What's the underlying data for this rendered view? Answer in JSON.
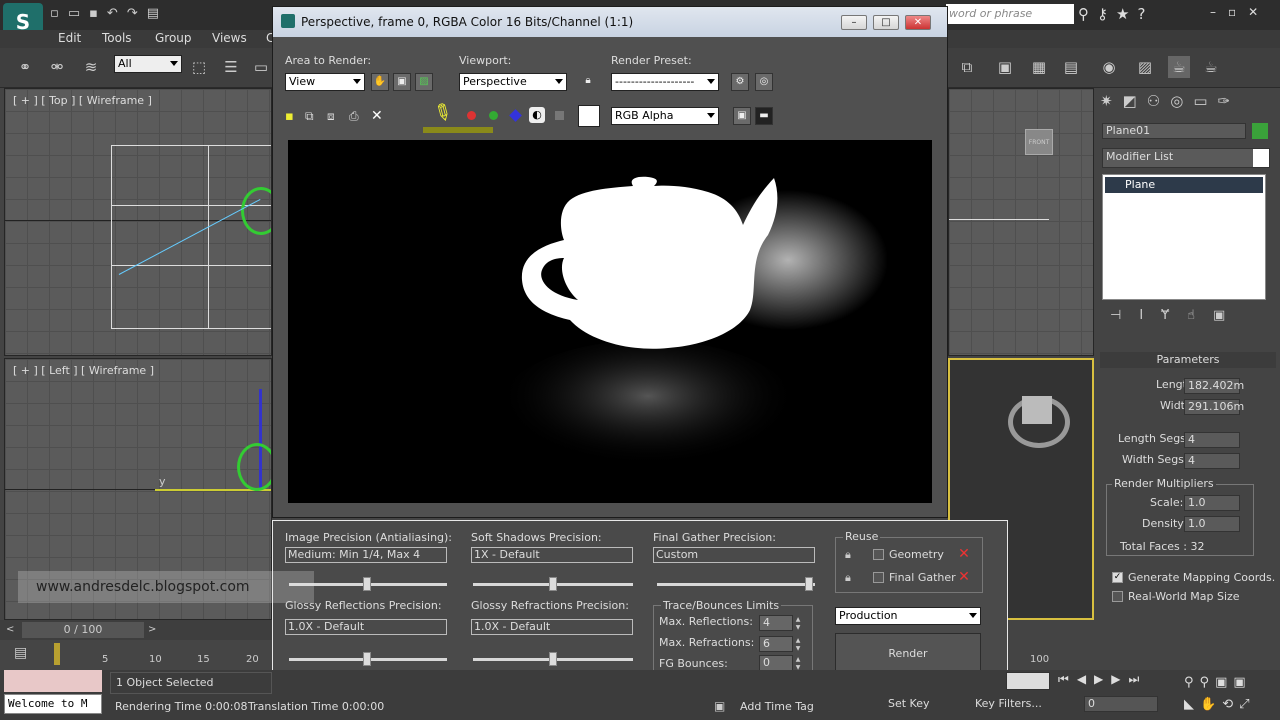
{
  "app": {
    "search_placeholder": "word or phrase"
  },
  "menu": {
    "items": [
      "Edit",
      "Tools",
      "Group",
      "Views",
      "C"
    ]
  },
  "toolbar": {
    "selection_filter": "All"
  },
  "viewports": {
    "top_label": "[ + ] [ Top ] [ Wireframe ]",
    "left_label": "[ + ] [ Left ] [ Wireframe ]",
    "axis_y": "y"
  },
  "render_window": {
    "title": "Perspective, frame 0, RGBA Color 16 Bits/Channel (1:1)",
    "area_label": "Area to Render:",
    "area_value": "View",
    "viewport_label": "Viewport:",
    "viewport_value": "Perspective",
    "preset_label": "Render Preset:",
    "preset_value": "--------------------",
    "channel_value": "RGB Alpha",
    "minimize": "–",
    "maximize": "□",
    "close": "✕"
  },
  "precision_panel": {
    "image_precision_label": "Image Precision (Antialiasing):",
    "image_precision_value": "Medium: Min 1/4, Max 4",
    "soft_shadows_label": "Soft Shadows Precision:",
    "soft_shadows_value": "1X - Default",
    "final_gather_label": "Final Gather Precision:",
    "final_gather_value": "Custom",
    "glossy_refl_label": "Glossy Reflections Precision:",
    "glossy_refl_value": "1.0X - Default",
    "glossy_refr_label": "Glossy Refractions Precision:",
    "glossy_refr_value": "1.0X - Default",
    "reuse_label": "Reuse",
    "geometry_label": "Geometry",
    "final_gather_chk_label": "Final Gather",
    "trace_label": "Trace/Bounces Limits",
    "max_refl_label": "Max. Reflections:",
    "max_refl_value": "4",
    "max_refr_label": "Max. Refractions:",
    "max_refr_value": "6",
    "fg_bounces_label": "FG Bounces:",
    "fg_bounces_value": "0",
    "production_value": "Production",
    "render_button": "Render",
    "watermark": "www.andresdelc.blogspot.com"
  },
  "command_panel": {
    "object_name": "Plane01",
    "modifier_list": "Modifier List",
    "stack_item": "Plane",
    "parameters_title": "Parameters",
    "length_label": "Length:",
    "length_value": "182.402m",
    "width_label": "Width:",
    "width_value": "291.106m",
    "length_segs_label": "Length Segs:",
    "length_segs_value": "4",
    "width_segs_label": "Width Segs:",
    "width_segs_value": "4",
    "render_mult_label": "Render Multipliers",
    "scale_label": "Scale:",
    "scale_value": "1.0",
    "density_label": "Density:",
    "density_value": "1.0",
    "total_faces": "Total Faces : 32",
    "gen_mapping": "Generate Mapping Coords.",
    "real_world": "Real-World Map Size"
  },
  "timeline": {
    "frame_counter": "0 / 100",
    "ticks": [
      "5",
      "10",
      "15",
      "20"
    ],
    "end_tick": "100"
  },
  "status": {
    "welcome": "Welcome to M",
    "selected": "1 Object Selected",
    "rendering_time": "Rendering Time  0:00:08",
    "translation_time": "Translation Time  0:00:00",
    "add_time_tag": "Add Time Tag",
    "set_key": "Set Key",
    "key_filters": "Key Filters...",
    "frame_field": "0"
  },
  "colors": {
    "accent_green": "#3aa23a",
    "close_red": "#e03a3a"
  }
}
